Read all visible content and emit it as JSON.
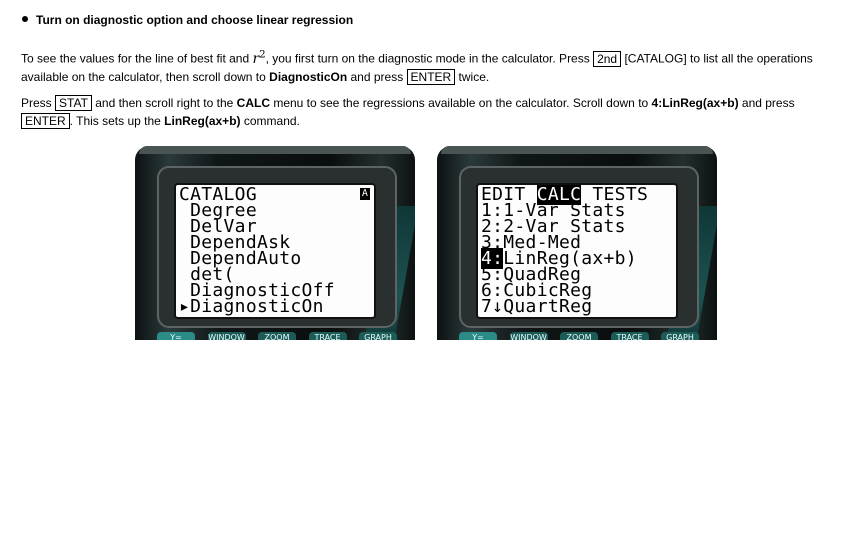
{
  "heading": "Turn on diagnostic option and choose linear regression",
  "paragraph1": {
    "t1": "To see the values for the line of best fit and ",
    "r2_base": "r",
    "r2_exp": "2",
    "t2": ", you first turn on the diagnostic mode in the calculator. Press ",
    "key_2nd": "2nd",
    "t3": " [CATALOG] to list all the operations available on the calculator, then scroll down to ",
    "diagnostic_on": "DiagnosticOn",
    "t4": " and press ",
    "key_enter": "ENTER",
    "t5": " twice."
  },
  "paragraph2": {
    "t1": "Press ",
    "key_stat": "STAT",
    "t2": " and then scroll right to the ",
    "calc": "CALC",
    "t3": " menu to see the regressions available on the calculator. Scroll down to ",
    "linreg_item": "4:LinReg(ax+b)",
    "t4": " and press",
    "key_enter": "ENTER",
    "t5": ". This sets up the ",
    "linreg_cmd": "LinReg(ax+b)",
    "t6": " command."
  },
  "calc_left": {
    "title": "CATALOG",
    "badge": "A",
    "lines": [
      " Degree",
      " DelVar",
      " DependAsk",
      " DependAuto",
      " det(",
      " DiagnosticOff",
      "▸DiagnosticOn"
    ],
    "fkeys": [
      "Y=",
      "WINDOW",
      "ZOOM",
      "TRACE",
      "GRAPH"
    ]
  },
  "calc_right": {
    "menu_edit": "EDIT",
    "menu_calc": "CALC",
    "menu_tests": "TESTS",
    "lines": [
      {
        "num": "1",
        "sep": ":",
        "text": "1-Var Stats"
      },
      {
        "num": "2",
        "sep": ":",
        "text": "2-Var Stats"
      },
      {
        "num": "3",
        "sep": ":",
        "text": "Med-Med"
      },
      {
        "num": "4",
        "sep": ":",
        "text": "LinReg(ax+b)"
      },
      {
        "num": "5",
        "sep": ":",
        "text": "QuadReg"
      },
      {
        "num": "6",
        "sep": ":",
        "text": "CubicReg"
      },
      {
        "num": "7",
        "sep": "↓",
        "text": "QuartReg"
      }
    ],
    "fkeys": [
      "Y=",
      "WINDOW",
      "ZOOM",
      "TRACE",
      "GRAPH"
    ]
  }
}
